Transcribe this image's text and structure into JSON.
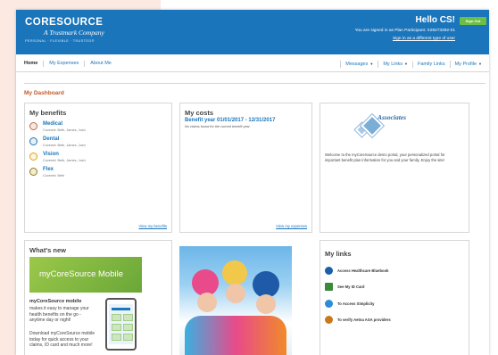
{
  "header": {
    "logo_main": "CORESOURCE",
    "logo_sub": "A Trustmark Company",
    "logo_tagline": "PERSONAL · FLEXIBLE · TRUSTED®",
    "greeting": "Hello CS!",
    "signed_in_as": "You are signed in as Plan Participant: X29273392-01",
    "sign_in_other": "Sign in as a different type of user",
    "sign_out": "Sign Out"
  },
  "nav": {
    "left": [
      "Home",
      "My Expenses",
      "About Me"
    ],
    "right": [
      "Messages",
      "My Links",
      "Family Links",
      "My Profile"
    ]
  },
  "dashboard_title": "My Dashboard",
  "benefits": {
    "title": "My benefits",
    "items": [
      {
        "name": "Medical",
        "covered": "Covered: Beth, James, Josh",
        "icon": "medical-icon"
      },
      {
        "name": "Dental",
        "covered": "Covered: Beth, James, Josh",
        "icon": "dental-icon"
      },
      {
        "name": "Vision",
        "covered": "Covered: Beth, James, Josh",
        "icon": "vision-icon"
      },
      {
        "name": "Flex",
        "covered": "Covered: Beth",
        "icon": "flex-dollar-icon"
      }
    ],
    "link": "View my benefits"
  },
  "costs": {
    "title": "My costs",
    "benefit_year": "Benefit year 01/01/2017 - 12/31/2017",
    "no_claims": "No claims found for the current benefit year.",
    "link": "View my expenses"
  },
  "associates": {
    "logo_text": "Associates",
    "welcome": "Welcome to the myCoreSource demo portal, your personalized portal for important benefit plan information for you and your family. Enjoy the site!"
  },
  "whats_new": {
    "title": "What's new",
    "banner": "myCoreSource Mobile",
    "mobile_title": "myCoreSource mobile",
    "mobile_desc": "makes it easy to manage your health benefits on the go - anytime day or night!",
    "mobile_desc2": "Download myCoreSource mobile today for quick access to your claims, ID card and much more!"
  },
  "links": {
    "title": "My links",
    "items": [
      {
        "label": "Access Healthcare Bluebook",
        "icon": "bluebook-icon",
        "color": "#1b5fa8"
      },
      {
        "label": "See My ID Card",
        "icon": "id-card-icon",
        "color": "#3a8a3a"
      },
      {
        "label": "To Access Simplicity",
        "icon": "simplicity-icon",
        "color": "#2b8dd6"
      },
      {
        "label": "To verify Aetna ASA providers",
        "icon": "aetna-search-icon",
        "color": "#c87a1a"
      }
    ]
  }
}
